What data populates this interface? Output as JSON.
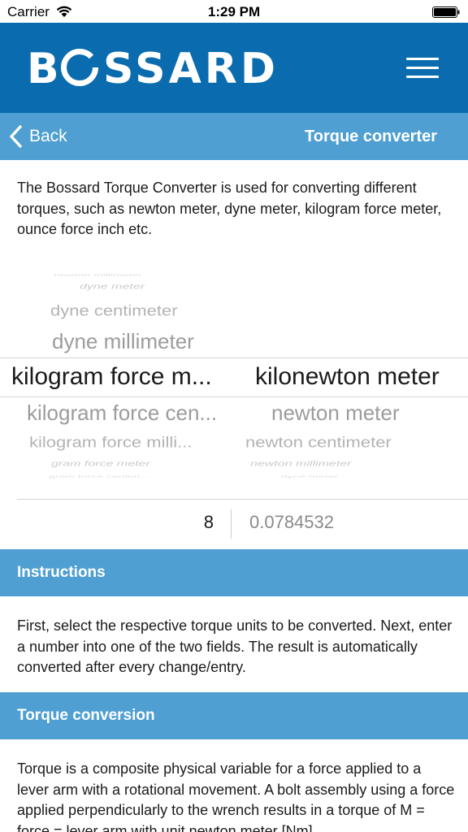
{
  "status_bar": {
    "carrier": "Carrier",
    "time": "1:29 PM"
  },
  "header": {
    "logo_text": "BOSSARD",
    "brand_color": "#0a6cae",
    "icons": [
      "menu-icon"
    ]
  },
  "subnav": {
    "back_label": "Back",
    "title": "Torque converter",
    "color": "#4f9fd2"
  },
  "intro": "The Bossard Torque Converter is used for converting different torques, such as newton meter, dyne meter, kilogram force meter, ounce force inch etc.",
  "picker": {
    "left_column": {
      "above": [
        "newton millimeter",
        "dyne meter",
        "dyne centimeter",
        "dyne millimeter"
      ],
      "selected": "kilogram force m...",
      "below": [
        "kilogram force cen...",
        "kilogram force milli...",
        "gram force meter",
        "gram force centim..."
      ]
    },
    "right_column": {
      "selected": "kilonewton meter",
      "below": [
        "newton meter",
        "newton centimeter",
        "newton millimeter",
        "dyne meter"
      ]
    }
  },
  "values": {
    "input": "8",
    "result": "0.0784532"
  },
  "instructions": {
    "title": "Instructions",
    "text": "First, select the respective torque units to be converted. Next, enter a number into one of the two fields. The result is automatically converted after every change/entry."
  },
  "torque_conversion": {
    "title": "Torque conversion",
    "text": "Torque is a composite physical variable for a force applied to a lever arm with a rotational movement. A bolt assembly using a force applied perpendicularly to the wrench results in a torque of M = force = lever arm with unit newton meter [Nm]."
  }
}
